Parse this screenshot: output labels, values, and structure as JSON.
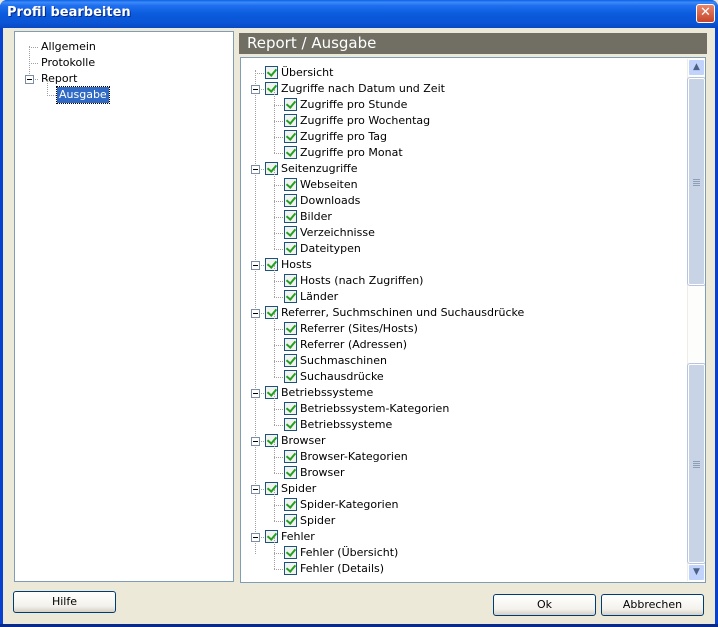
{
  "window": {
    "title": "Profil bearbeiten",
    "close_icon": "close-icon"
  },
  "nav": {
    "items": [
      {
        "label": "Allgemein",
        "level": 0,
        "selected": false
      },
      {
        "label": "Protokolle",
        "level": 0,
        "selected": false
      },
      {
        "label": "Report",
        "level": 0,
        "expanded": true,
        "selected": false
      },
      {
        "label": "Ausgabe",
        "level": 1,
        "selected": true
      }
    ]
  },
  "panel": {
    "header": "Report / Ausgabe",
    "tree": [
      {
        "label": "Übersicht",
        "level": 0,
        "checked": true
      },
      {
        "label": "Zugriffe nach Datum und Zeit",
        "level": 0,
        "checked": true,
        "expanded": true
      },
      {
        "label": "Zugriffe pro Stunde",
        "level": 1,
        "checked": true
      },
      {
        "label": "Zugriffe pro Wochentag",
        "level": 1,
        "checked": true
      },
      {
        "label": "Zugriffe pro Tag",
        "level": 1,
        "checked": true
      },
      {
        "label": "Zugriffe pro Monat",
        "level": 1,
        "checked": true
      },
      {
        "label": "Seitenzugriffe",
        "level": 0,
        "checked": true,
        "expanded": true
      },
      {
        "label": "Webseiten",
        "level": 1,
        "checked": true
      },
      {
        "label": "Downloads",
        "level": 1,
        "checked": true
      },
      {
        "label": "Bilder",
        "level": 1,
        "checked": true
      },
      {
        "label": "Verzeichnisse",
        "level": 1,
        "checked": true
      },
      {
        "label": "Dateitypen",
        "level": 1,
        "checked": true
      },
      {
        "label": "Hosts",
        "level": 0,
        "checked": true,
        "expanded": true
      },
      {
        "label": "Hosts (nach Zugriffen)",
        "level": 1,
        "checked": true
      },
      {
        "label": "Länder",
        "level": 1,
        "checked": true
      },
      {
        "label": "Referrer, Suchmschinen und Suchausdrücke",
        "level": 0,
        "checked": true,
        "expanded": true
      },
      {
        "label": "Referrer (Sites/Hosts)",
        "level": 1,
        "checked": true
      },
      {
        "label": "Referrer (Adressen)",
        "level": 1,
        "checked": true
      },
      {
        "label": "Suchmaschinen",
        "level": 1,
        "checked": true
      },
      {
        "label": "Suchausdrücke",
        "level": 1,
        "checked": true
      },
      {
        "label": "Betriebssysteme",
        "level": 0,
        "checked": true,
        "expanded": true
      },
      {
        "label": "Betriebssystem-Kategorien",
        "level": 1,
        "checked": true
      },
      {
        "label": "Betriebssysteme",
        "level": 1,
        "checked": true
      },
      {
        "label": "Browser",
        "level": 0,
        "checked": true,
        "expanded": true
      },
      {
        "label": "Browser-Kategorien",
        "level": 1,
        "checked": true
      },
      {
        "label": "Browser",
        "level": 1,
        "checked": true
      },
      {
        "label": "Spider",
        "level": 0,
        "checked": true,
        "expanded": true
      },
      {
        "label": "Spider-Kategorien",
        "level": 1,
        "checked": true
      },
      {
        "label": "Spider",
        "level": 1,
        "checked": true
      },
      {
        "label": "Fehler",
        "level": 0,
        "checked": true,
        "expanded": true
      },
      {
        "label": "Fehler (Übersicht)",
        "level": 1,
        "checked": true
      },
      {
        "label": "Fehler (Details)",
        "level": 1,
        "checked": true
      }
    ],
    "scrollbar": {
      "up_icon": "chevron-up-icon",
      "down_icon": "chevron-down-icon"
    }
  },
  "buttons": {
    "help": "Hilfe",
    "ok": "Ok",
    "cancel": "Abbrechen"
  }
}
